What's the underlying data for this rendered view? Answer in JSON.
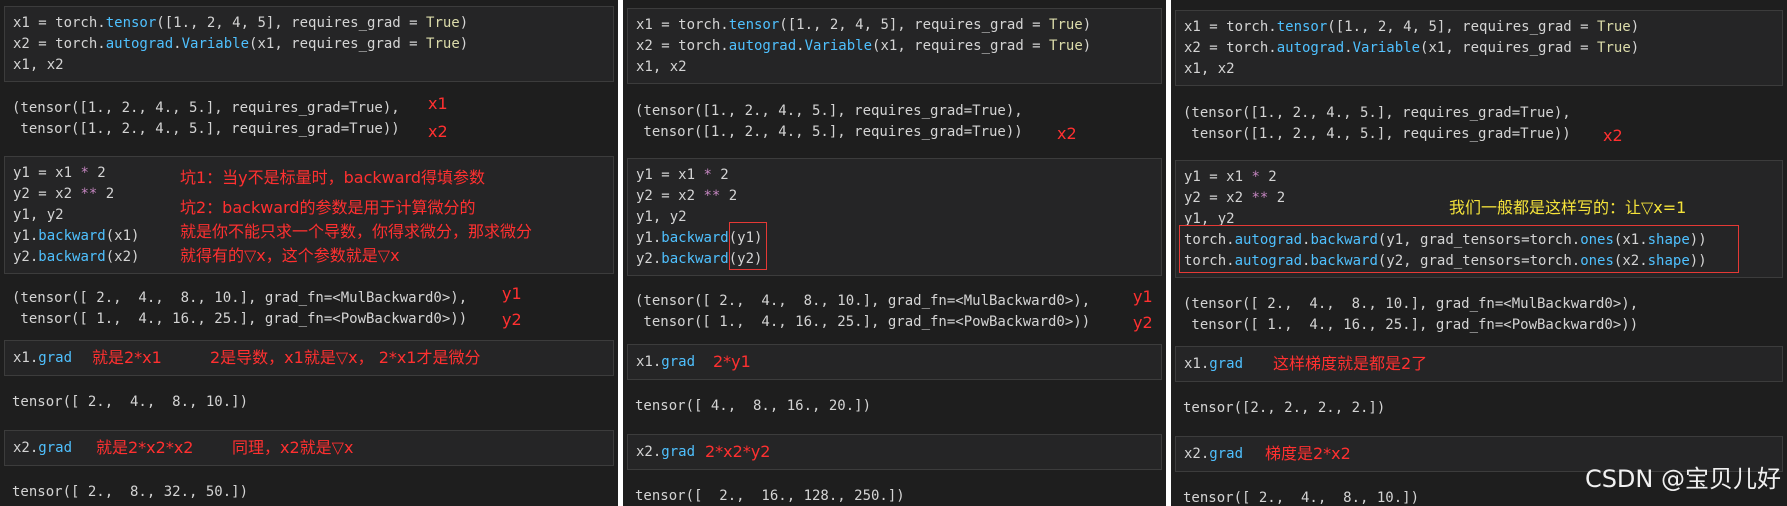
{
  "panels": [
    {
      "code1": {
        "l1": [
          "x1 = torch.",
          "tensor",
          "([1., 2, 4, 5], requires_grad = ",
          "True",
          ")"
        ],
        "l2": [
          "x2 = torch.",
          "autograd",
          ".",
          "Variable",
          "(x1, requires_grad = ",
          "True",
          ")"
        ],
        "l3": "x1, x2"
      },
      "out1": {
        "l1": "(tensor([1., 2., 4., 5.], requires_grad=True),",
        "l2": " tensor([1., 2., 4., 5.], requires_grad=True))"
      },
      "out1_notes": [
        "x1",
        "x2"
      ],
      "code2": {
        "l1": [
          "y1 = x1 ",
          "*",
          " 2"
        ],
        "l2": [
          "y2 = x2 ",
          "**",
          " 2"
        ],
        "l3": "y1, y2",
        "l4": [
          "y1.",
          "backward",
          "(x1)"
        ],
        "l5": [
          "y2.",
          "backward",
          "(x2)"
        ]
      },
      "code2_notes": [
        "坑1：当y不是标量时，backward得填参数",
        "坑2：backward的参数是用于计算微分的",
        "就是你不能只求一个导数，你得求微分，那求微分",
        "就得有的▽x，这个参数就是▽x"
      ],
      "out2": {
        "l1": "(tensor([ 2.,  4.,  8., 10.], grad_fn=<MulBackward0>),",
        "l2": " tensor([ 1.,  4., 16., 25.], grad_fn=<PowBackward0>))"
      },
      "out2_notes": [
        "y1",
        "y2"
      ],
      "code3": [
        "x1.",
        "grad"
      ],
      "code3_notes": [
        "就是2*x1",
        "2是导数，x1就是▽x， 2*x1才是微分"
      ],
      "out3": "tensor([ 2.,  4.,  8., 10.])",
      "code4": [
        "x2.",
        "grad"
      ],
      "code4_notes": [
        "就是2*x2*x2",
        "同理，x2就是▽x"
      ],
      "out4": "tensor([ 2.,  8., 32., 50.])"
    },
    {
      "code1": {
        "l1": [
          "x1 = torch.",
          "tensor",
          "([1., 2, 4, 5], requires_grad = ",
          "True",
          ")"
        ],
        "l2": [
          "x2 = torch.",
          "autograd",
          ".",
          "Variable",
          "(x1, requires_grad = ",
          "True",
          ")"
        ],
        "l3": "x1, x2"
      },
      "out1": {
        "l1": "(tensor([1., 2., 4., 5.], requires_grad=True),",
        "l2": " tensor([1., 2., 4., 5.], requires_grad=True))"
      },
      "out1_notes": [
        "x2"
      ],
      "code2": {
        "l1": [
          "y1 = x1 ",
          "*",
          " 2"
        ],
        "l2": [
          "y2 = x2 ",
          "**",
          " 2"
        ],
        "l3": "y1, y2",
        "l4": [
          "y1.",
          "backward",
          "(y1)"
        ],
        "l5": [
          "y2.",
          "backward",
          "(y2)"
        ]
      },
      "out2": {
        "l1": "(tensor([ 2.,  4.,  8., 10.], grad_fn=<MulBackward0>),",
        "l2": " tensor([ 1.,  4., 16., 25.], grad_fn=<PowBackward0>))"
      },
      "out2_notes": [
        "y1",
        "y2"
      ],
      "code3": [
        "x1.",
        "grad"
      ],
      "code3_notes": [
        "2*y1"
      ],
      "out3": "tensor([ 4.,  8., 16., 20.])",
      "code4": [
        "x2.",
        "grad"
      ],
      "code4_notes": [
        "2*x2*y2"
      ],
      "out4": "tensor([  2.,  16., 128., 250.])"
    },
    {
      "code1": {
        "l1": [
          "x1 = torch.",
          "tensor",
          "([1., 2, 4, 5], requires_grad = ",
          "True",
          ")"
        ],
        "l2": [
          "x2 = torch.",
          "autograd",
          ".",
          "Variable",
          "(x1, requires_grad = ",
          "True",
          ")"
        ],
        "l3": "x1, x2"
      },
      "out1": {
        "l1": "(tensor([1., 2., 4., 5.], requires_grad=True),",
        "l2": " tensor([1., 2., 4., 5.], requires_grad=True))"
      },
      "out1_notes": [
        "x2"
      ],
      "code2": {
        "l1": [
          "y1 = x1 ",
          "*",
          " 2"
        ],
        "l2": [
          "y2 = x2 ",
          "**",
          " 2"
        ],
        "l3": "y1, y2",
        "l4": [
          "torch.",
          "autograd",
          ".",
          "backward",
          "(y1, grad_tensors=torch.",
          "ones",
          "(x1.",
          "shape",
          "))"
        ],
        "l5": [
          "torch.",
          "autograd",
          ".",
          "backward",
          "(y2, grad_tensors=torch.",
          "ones",
          "(x2.",
          "shape",
          "))"
        ]
      },
      "code2_notes": [
        "我们一般都是这样写的：让▽x=1"
      ],
      "out2": {
        "l1": "(tensor([ 2.,  4.,  8., 10.], grad_fn=<MulBackward0>),",
        "l2": " tensor([ 1.,  4., 16., 25.], grad_fn=<PowBackward0>))"
      },
      "code3": [
        "x1.",
        "grad"
      ],
      "code3_notes": [
        "这样梯度就是都是2了"
      ],
      "out3": "tensor([2., 2., 2., 2.])",
      "code4": [
        "x2.",
        "grad"
      ],
      "code4_notes": [
        "梯度是2*x2"
      ],
      "out4": "tensor([ 2.,  4.,  8., 10.])"
    }
  ],
  "watermark": "CSDN @宝贝儿好"
}
